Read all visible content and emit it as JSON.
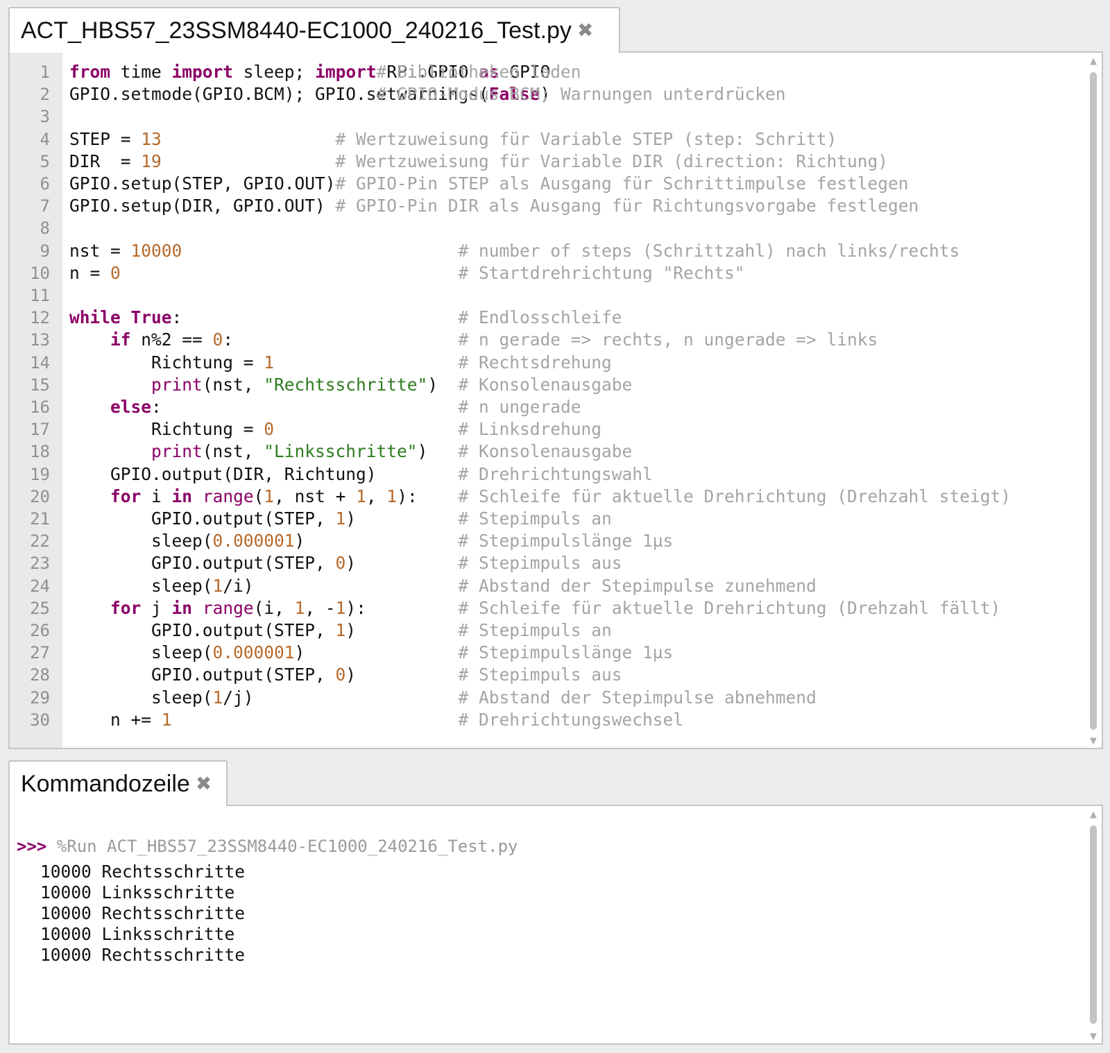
{
  "editor": {
    "tab_title": "ACT_HBS57_23SSM8440-EC1000_240216_Test.py",
    "close_icon": "close-icon",
    "lines": [
      {
        "num": "1",
        "code": [
          {
            "t": "from",
            "c": "kw"
          },
          {
            "t": " time "
          },
          {
            "t": "import",
            "c": "kw"
          },
          {
            "t": " sleep; "
          },
          {
            "t": "import",
            "c": "kw"
          },
          {
            "t": " RPi.GPIO "
          },
          {
            "t": "as",
            "c": "kw"
          },
          {
            "t": " GPIO"
          }
        ],
        "comment": "# Bibliotheken laden",
        "ccol": 30
      },
      {
        "num": "2",
        "code": [
          {
            "t": "GPIO.setmode(GPIO.BCM); GPIO.setwarnings("
          },
          {
            "t": "False",
            "c": "kw"
          },
          {
            "t": ")"
          }
        ],
        "comment": "# GPIO-Modus BCM; Warnungen unterdrücken",
        "ccol": 30
      },
      {
        "num": "3",
        "code": [],
        "comment": "",
        "ccol": 0
      },
      {
        "num": "4",
        "code": [
          {
            "t": "STEP = "
          },
          {
            "t": "13",
            "c": "num"
          }
        ],
        "comment": "# Wertzuweisung für Variable STEP (step: Schritt)",
        "ccol": 26
      },
      {
        "num": "5",
        "code": [
          {
            "t": "DIR  = "
          },
          {
            "t": "19",
            "c": "num"
          }
        ],
        "comment": "# Wertzuweisung für Variable DIR (direction: Richtung)",
        "ccol": 26
      },
      {
        "num": "6",
        "code": [
          {
            "t": "GPIO.setup(STEP, GPIO.OUT)"
          }
        ],
        "comment": "# GPIO-Pin STEP als Ausgang für Schrittimpulse festlegen",
        "ccol": 26
      },
      {
        "num": "7",
        "code": [
          {
            "t": "GPIO.setup(DIR, GPIO.OUT)"
          }
        ],
        "comment": "# GPIO-Pin DIR als Ausgang für Richtungsvorgabe festlegen",
        "ccol": 26
      },
      {
        "num": "8",
        "code": [],
        "comment": "",
        "ccol": 0
      },
      {
        "num": "9",
        "code": [
          {
            "t": "nst = "
          },
          {
            "t": "10000",
            "c": "num"
          }
        ],
        "comment": "# number of steps (Schrittzahl) nach links/rechts",
        "ccol": 38
      },
      {
        "num": "10",
        "code": [
          {
            "t": "n = "
          },
          {
            "t": "0",
            "c": "num"
          }
        ],
        "comment": "# Startdrehrichtung \"Rechts\"",
        "ccol": 38
      },
      {
        "num": "11",
        "code": [],
        "comment": "",
        "ccol": 0
      },
      {
        "num": "12",
        "code": [
          {
            "t": "while",
            "c": "kw"
          },
          {
            "t": " "
          },
          {
            "t": "True",
            "c": "kw"
          },
          {
            "t": ":"
          }
        ],
        "comment": "# Endlosschleife",
        "ccol": 38
      },
      {
        "num": "13",
        "code": [
          {
            "t": "    "
          },
          {
            "t": "if",
            "c": "kw"
          },
          {
            "t": " n%2 == "
          },
          {
            "t": "0",
            "c": "num"
          },
          {
            "t": ":"
          }
        ],
        "comment": "# n gerade => rechts, n ungerade => links",
        "ccol": 38
      },
      {
        "num": "14",
        "code": [
          {
            "t": "        Richtung = "
          },
          {
            "t": "1",
            "c": "num"
          }
        ],
        "comment": "# Rechtsdrehung",
        "ccol": 38
      },
      {
        "num": "15",
        "code": [
          {
            "t": "        "
          },
          {
            "t": "print",
            "c": "bi"
          },
          {
            "t": "(nst, "
          },
          {
            "t": "\"Rechtsschritte\"",
            "c": "str"
          },
          {
            "t": ")"
          }
        ],
        "comment": "# Konsolenausgabe",
        "ccol": 38
      },
      {
        "num": "16",
        "code": [
          {
            "t": "    "
          },
          {
            "t": "else",
            "c": "kw"
          },
          {
            "t": ":"
          }
        ],
        "comment": "# n ungerade",
        "ccol": 38
      },
      {
        "num": "17",
        "code": [
          {
            "t": "        Richtung = "
          },
          {
            "t": "0",
            "c": "num"
          }
        ],
        "comment": "# Linksdrehung",
        "ccol": 38
      },
      {
        "num": "18",
        "code": [
          {
            "t": "        "
          },
          {
            "t": "print",
            "c": "bi"
          },
          {
            "t": "(nst, "
          },
          {
            "t": "\"Linksschritte\"",
            "c": "str"
          },
          {
            "t": ")"
          }
        ],
        "comment": "# Konsolenausgabe",
        "ccol": 38
      },
      {
        "num": "19",
        "code": [
          {
            "t": "    GPIO.output(DIR, Richtung)"
          }
        ],
        "comment": "# Drehrichtungswahl",
        "ccol": 38
      },
      {
        "num": "20",
        "code": [
          {
            "t": "    "
          },
          {
            "t": "for",
            "c": "kw"
          },
          {
            "t": " i "
          },
          {
            "t": "in",
            "c": "kw"
          },
          {
            "t": " "
          },
          {
            "t": "range",
            "c": "bi"
          },
          {
            "t": "("
          },
          {
            "t": "1",
            "c": "num"
          },
          {
            "t": ", nst + "
          },
          {
            "t": "1",
            "c": "num"
          },
          {
            "t": ", "
          },
          {
            "t": "1",
            "c": "num"
          },
          {
            "t": "):"
          }
        ],
        "comment": "# Schleife für aktuelle Drehrichtung (Drehzahl steigt)",
        "ccol": 38
      },
      {
        "num": "21",
        "code": [
          {
            "t": "        GPIO.output(STEP, "
          },
          {
            "t": "1",
            "c": "num"
          },
          {
            "t": ")"
          }
        ],
        "comment": "# Stepimpuls an",
        "ccol": 38
      },
      {
        "num": "22",
        "code": [
          {
            "t": "        sleep("
          },
          {
            "t": "0.000001",
            "c": "num"
          },
          {
            "t": ")"
          }
        ],
        "comment": "# Stepimpulslänge 1µs",
        "ccol": 38
      },
      {
        "num": "23",
        "code": [
          {
            "t": "        GPIO.output(STEP, "
          },
          {
            "t": "0",
            "c": "num"
          },
          {
            "t": ")"
          }
        ],
        "comment": "# Stepimpuls aus",
        "ccol": 38
      },
      {
        "num": "24",
        "code": [
          {
            "t": "        sleep("
          },
          {
            "t": "1",
            "c": "num"
          },
          {
            "t": "/i)"
          }
        ],
        "comment": "# Abstand der Stepimpulse zunehmend",
        "ccol": 38
      },
      {
        "num": "25",
        "code": [
          {
            "t": "    "
          },
          {
            "t": "for",
            "c": "kw"
          },
          {
            "t": " j "
          },
          {
            "t": "in",
            "c": "kw"
          },
          {
            "t": " "
          },
          {
            "t": "range",
            "c": "bi"
          },
          {
            "t": "(i, "
          },
          {
            "t": "1",
            "c": "num"
          },
          {
            "t": ", -"
          },
          {
            "t": "1",
            "c": "num"
          },
          {
            "t": "):"
          }
        ],
        "comment": "# Schleife für aktuelle Drehrichtung (Drehzahl fällt)",
        "ccol": 38
      },
      {
        "num": "26",
        "code": [
          {
            "t": "        GPIO.output(STEP, "
          },
          {
            "t": "1",
            "c": "num"
          },
          {
            "t": ")"
          }
        ],
        "comment": "# Stepimpuls an",
        "ccol": 38
      },
      {
        "num": "27",
        "code": [
          {
            "t": "        sleep("
          },
          {
            "t": "0.000001",
            "c": "num"
          },
          {
            "t": ")"
          }
        ],
        "comment": "# Stepimpulslänge 1µs",
        "ccol": 38
      },
      {
        "num": "28",
        "code": [
          {
            "t": "        GPIO.output(STEP, "
          },
          {
            "t": "0",
            "c": "num"
          },
          {
            "t": ")"
          }
        ],
        "comment": "# Stepimpuls aus",
        "ccol": 38
      },
      {
        "num": "29",
        "code": [
          {
            "t": "        sleep("
          },
          {
            "t": "1",
            "c": "num"
          },
          {
            "t": "/j)"
          }
        ],
        "comment": "# Abstand der Stepimpulse abnehmend",
        "ccol": 38
      },
      {
        "num": "30",
        "code": [
          {
            "t": "    n += "
          },
          {
            "t": "1",
            "c": "num"
          }
        ],
        "comment": "# Drehrichtungswechsel",
        "ccol": 38
      }
    ]
  },
  "shell": {
    "tab_title": "Kommandozeile",
    "close_icon": "close-icon",
    "prompt": ">>>",
    "command": "%Run ACT_HBS57_23SSM8440-EC1000_240216_Test.py",
    "output": [
      "10000 Rechtsschritte",
      "10000 Linksschritte",
      "10000 Rechtsschritte",
      "10000 Linksschritte",
      "10000 Rechtsschritte"
    ]
  },
  "colors": {
    "keyword": "#8b0067",
    "number": "#b6692a",
    "string": "#2d7b1e",
    "comment": "#a4a4a4",
    "gutter_bg": "#e9e9e9"
  }
}
